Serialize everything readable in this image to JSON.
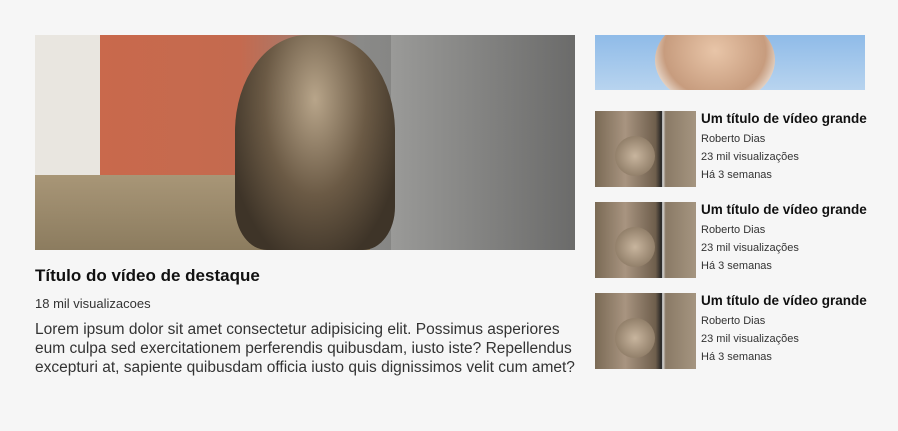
{
  "featured": {
    "title": "Título do vídeo de destaque",
    "views": "18 mil visualizacoes",
    "description": "Lorem ipsum dolor sit amet consectetur adipisicing elit. Possimus asperiores eum culpa sed exercitationem perferendis quibusdam, iusto iste? Repellendus excepturi at, sapiente quibusdam officia iusto quis dignissimos velit cum amet?"
  },
  "sidebar": {
    "items": [
      {
        "title": "Um título de vídeo grande",
        "author": "Roberto Dias",
        "views": "23 mil visualizações",
        "age": "Há 3 semanas"
      },
      {
        "title": "Um título de vídeo grande",
        "author": "Roberto Dias",
        "views": "23 mil visualizações",
        "age": "Há 3 semanas"
      },
      {
        "title": "Um título de vídeo grande",
        "author": "Roberto Dias",
        "views": "23 mil visualizações",
        "age": "Há 3 semanas"
      }
    ]
  }
}
